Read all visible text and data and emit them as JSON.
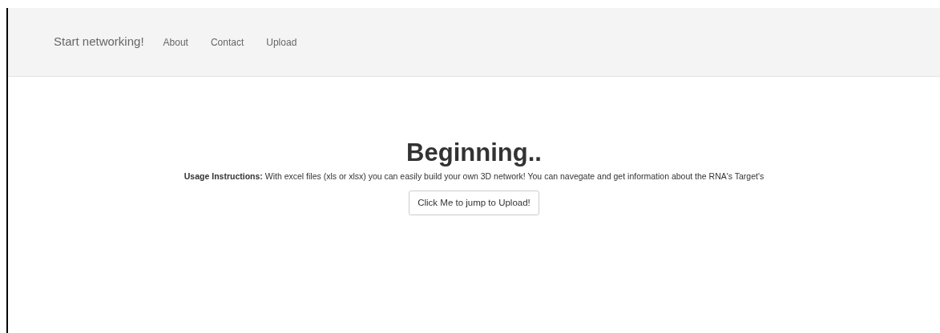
{
  "navbar": {
    "brand": "Start networking!",
    "links": [
      {
        "label": "About"
      },
      {
        "label": "Contact"
      },
      {
        "label": "Upload"
      }
    ]
  },
  "main": {
    "heading": "Beginning..",
    "instructions": "**Usage Instructions:** With excel files (xls or xlsx) you can easily build your own 3D network! You can navegate and get information about the RNA's Target's",
    "button": "Click Me to jump to Upload!"
  }
}
